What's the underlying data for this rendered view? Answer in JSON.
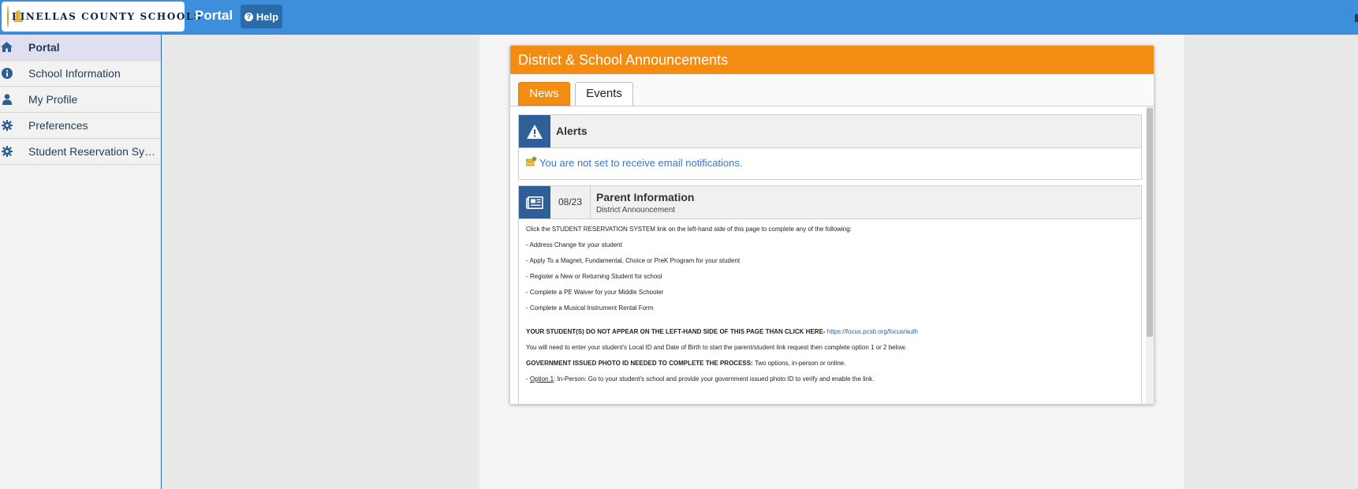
{
  "header": {
    "logo_text": "PINELLAS COUNTY SCHOOLS",
    "app_title": "Portal",
    "help_label": "Help"
  },
  "sidebar": {
    "items": [
      {
        "label": "Portal",
        "icon": "home-icon"
      },
      {
        "label": "School Information",
        "icon": "info-circle-icon"
      },
      {
        "label": "My Profile",
        "icon": "user-icon"
      },
      {
        "label": "Preferences",
        "icon": "gear-icon"
      },
      {
        "label": "Student Reservation Syst...",
        "icon": "gear-icon"
      }
    ]
  },
  "panel": {
    "title": "District & School Announcements",
    "tabs": [
      {
        "label": "News",
        "active": true
      },
      {
        "label": "Events",
        "active": false
      }
    ]
  },
  "alerts": {
    "title": "Alerts",
    "message": "You are not set to receive email notifications."
  },
  "news_item": {
    "date": "08/23",
    "title": "Parent Information",
    "subtitle": "District Announcement",
    "body": {
      "line1": "Click the STUDENT RESERVATION SYSTEM link on the left-hand side of this page to complete any of  the following:",
      "line2": " - Address Change for your student",
      "line3": " - Apply To a Magnet, Fundamental, Choice or  PreK Program for your student",
      "line4": " - Register a New or Returning Student for school",
      "line5": "- Complete a PE Waiver for your Middle Schooler",
      "line6": "- Complete a Musical Instrument Rental Form",
      "line7_bold": "YOUR STUDENT(S) DO NOT APPEAR ON THE LEFT-HAND SIDE OF THIS PAGE THAN CLICK HERE- ",
      "line7_link": "https://focus.pcsb.org/focus/auth",
      "line8": "You will need to enter your student's Local ID and Date of Birth to start the parent/student link request then complete option 1 or 2 below.",
      "line9_bold": "GOVERNMENT ISSUED PHOTO ID NEEDED TO COMPLETE THE PROCESS:",
      "line9_rest": " Two options, in-person or online.",
      "line10_prefix": " - ",
      "line10_underline": "Option 1",
      "line10_rest": ": In-Person: Go to your student's school and provide your government issued photo ID to verify and enable the link."
    }
  },
  "colors": {
    "topbar": "#3d8fdc",
    "accent_orange": "#f28c12",
    "icon_blue": "#2f5f96",
    "link_blue": "#3a78c2"
  }
}
